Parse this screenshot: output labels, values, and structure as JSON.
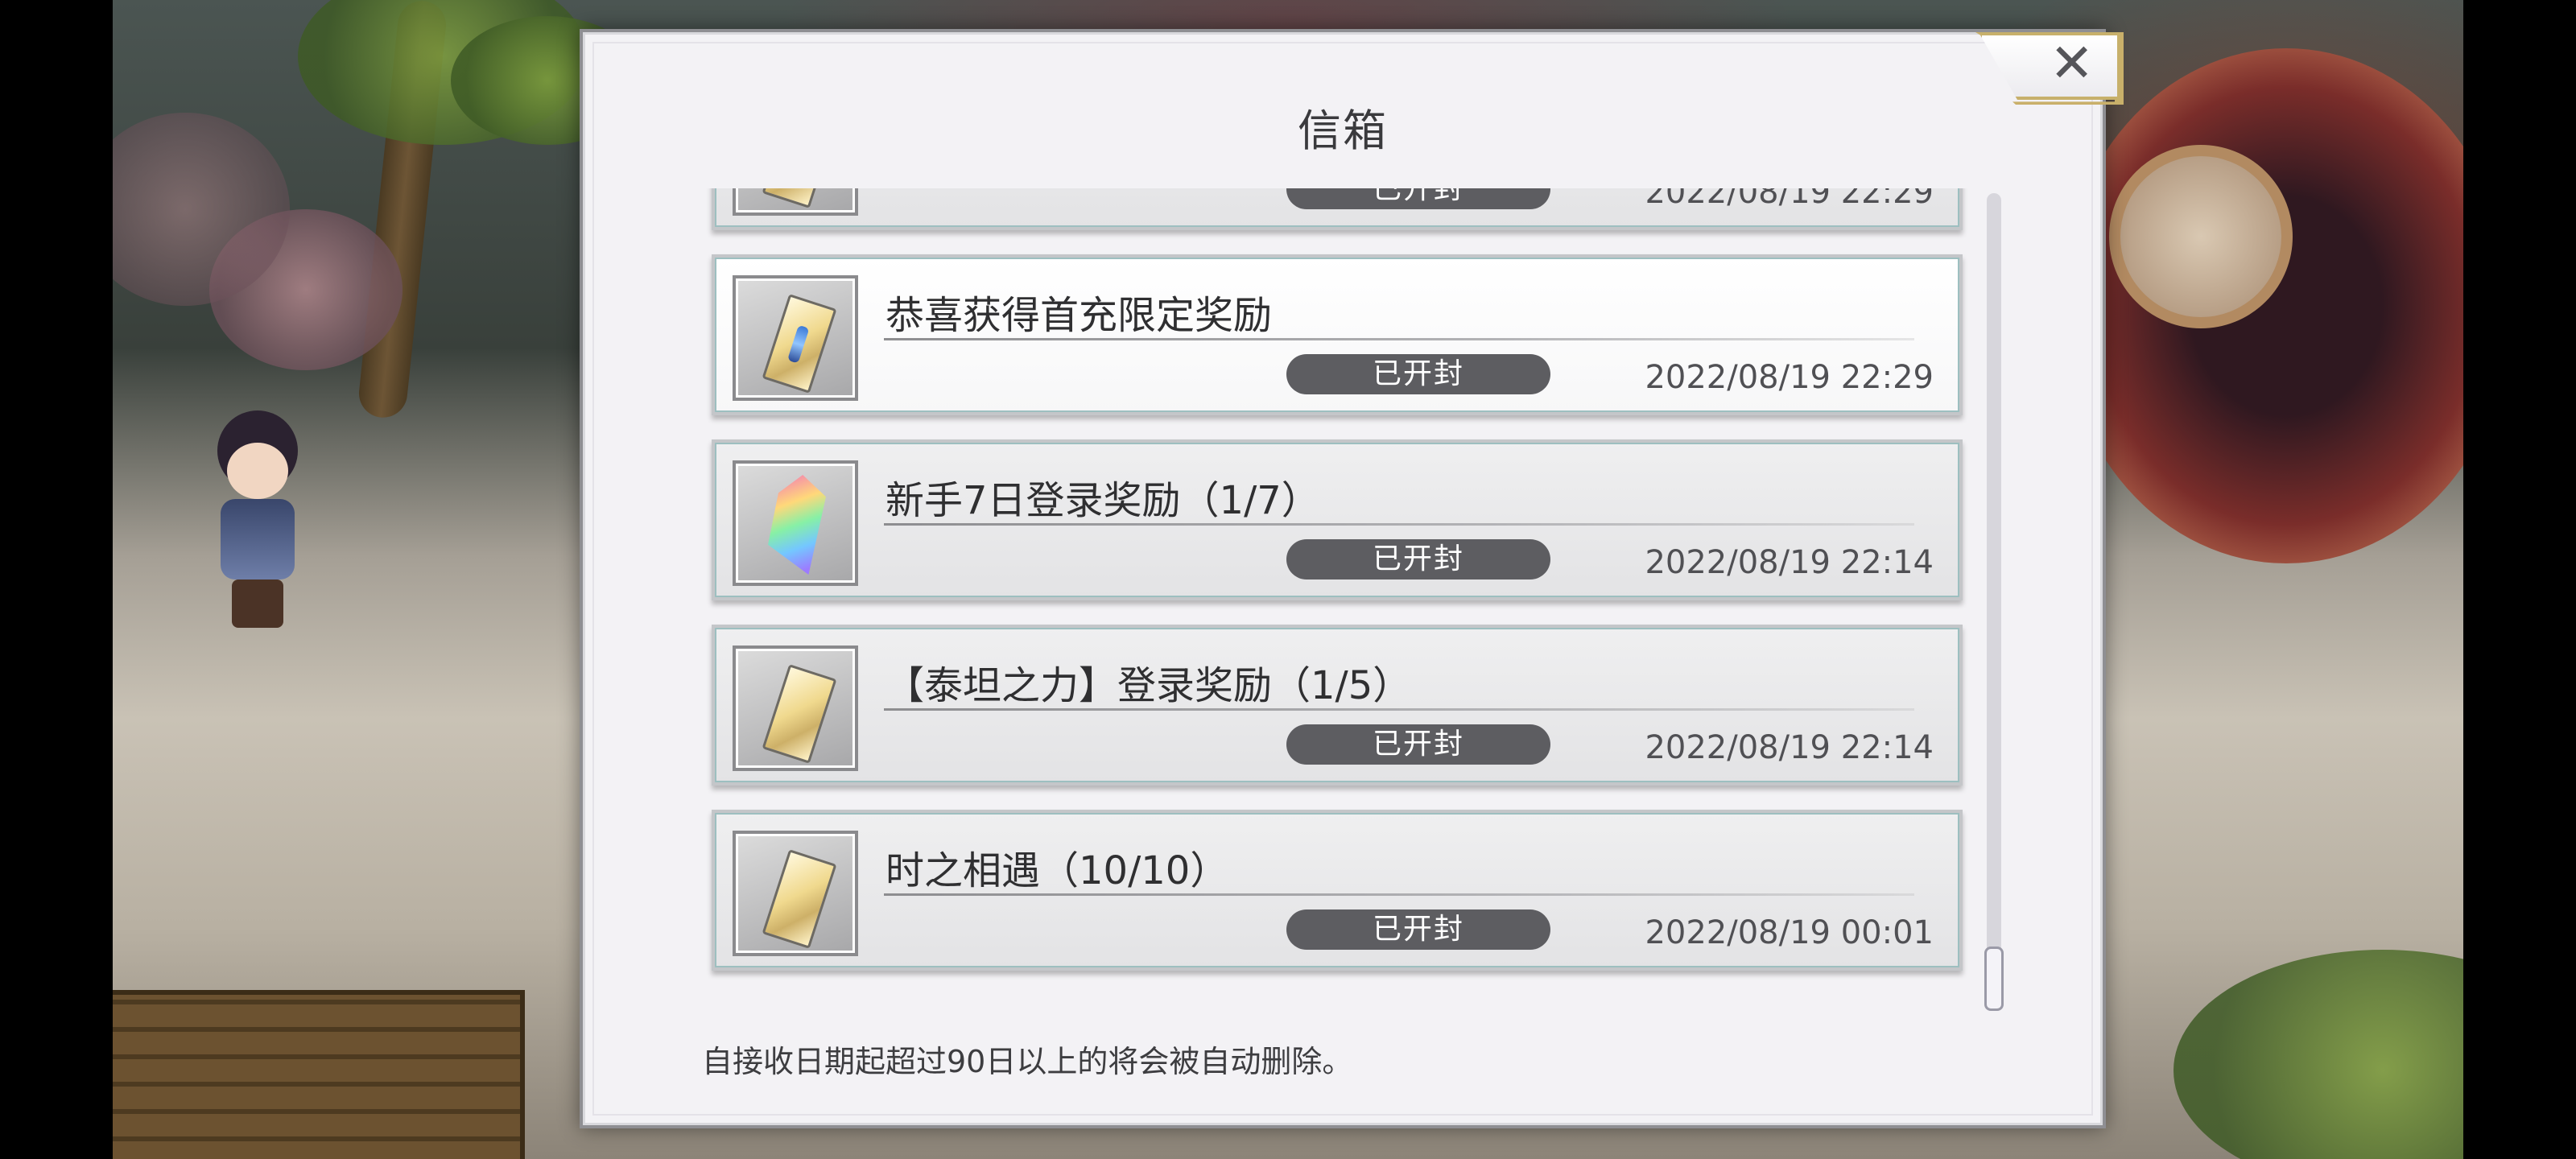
{
  "dialog": {
    "title": "信箱",
    "close_label": "✕",
    "footer_note": "自接收日期起超过90日以上的将会被自动删除。"
  },
  "mails": [
    {
      "subject": "",
      "status": "已开封",
      "date": "2022/08/19 22:29",
      "icon": "item-icon",
      "unread": false
    },
    {
      "subject": "恭喜获得首充限定奖励",
      "status": "已开封",
      "date": "2022/08/19 22:29",
      "icon": "ticket-icon",
      "unread": true
    },
    {
      "subject": "新手7日登录奖励（1/7）",
      "status": "已开封",
      "date": "2022/08/19 22:14",
      "icon": "crystal-icon",
      "unread": false
    },
    {
      "subject": "【泰坦之力】登录奖励（1/5）",
      "status": "已开封",
      "date": "2022/08/19 22:14",
      "icon": "ticket-icon",
      "unread": false
    },
    {
      "subject": "时之相遇（10/10）",
      "status": "已开封",
      "date": "2022/08/19 00:01",
      "icon": "ticket-icon",
      "unread": false
    }
  ],
  "scroll_position": 1.0,
  "colors": {
    "badge": "#5d5d61",
    "dialog_bg": "#f3f2f5",
    "close_border": "#c7b06b"
  }
}
